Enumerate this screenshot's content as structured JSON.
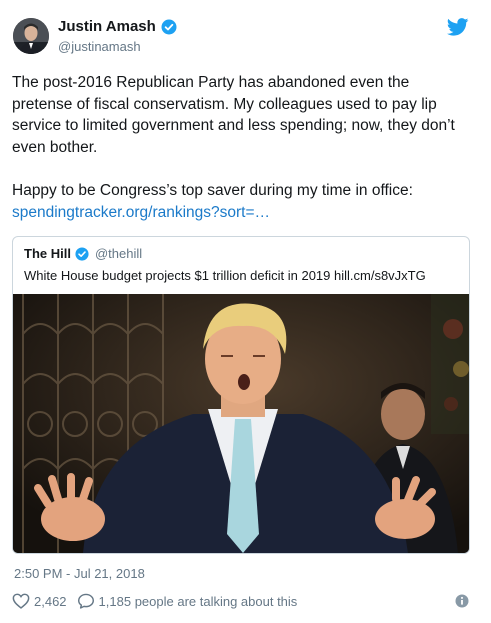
{
  "author": {
    "name": "Justin Amash",
    "handle": "@justinamash"
  },
  "tweet": {
    "paragraph1": "The post-2016 Republican Party has abandoned even the pretense of fiscal conservatism. My colleagues used to pay lip service to limited government and less spending; now, they don’t even bother.",
    "paragraph2": "Happy to be Congress’s top saver during my time in office:",
    "link": "spendingtracker.org/rankings?sort=…"
  },
  "quoted": {
    "name": "The Hill",
    "handle": "@thehill",
    "text": "White House budget projects $1 trillion deficit in 2019 hill.cm/s8vJxTG"
  },
  "timestamp": "2:50 PM - Jul 21, 2018",
  "stats": {
    "likes": "2,462",
    "replies": "1,185 people are talking about this"
  },
  "colors": {
    "verified": "#1da1f2",
    "link": "#1b7ac9",
    "muted": "#657786",
    "border": "#ccd6dd"
  },
  "icons": {
    "verified": "verified-badge-icon",
    "brand": "twitter-bird-icon",
    "like": "heart-icon",
    "reply": "speech-bubble-icon",
    "info": "info-icon"
  }
}
